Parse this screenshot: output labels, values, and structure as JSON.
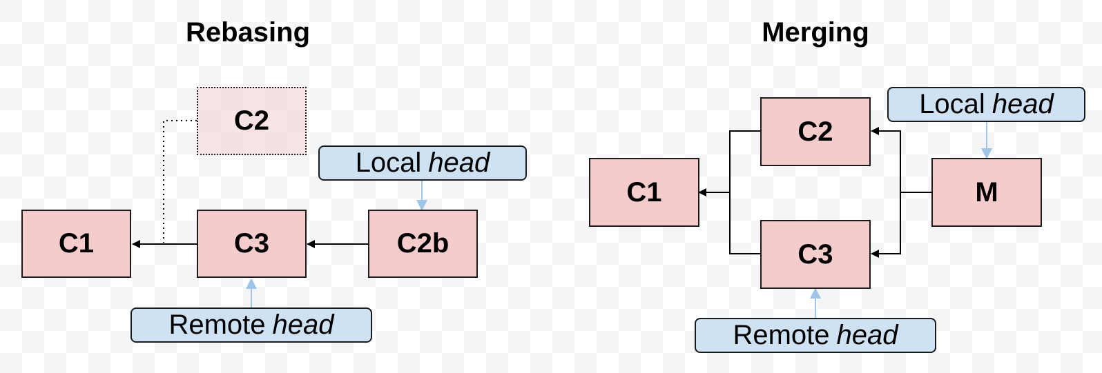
{
  "diagrams": {
    "rebasing": {
      "title": "Rebasing",
      "commits": {
        "c1": "C1",
        "c3": "C3",
        "c2b": "C2b",
        "c2_original": "C2"
      },
      "refs": {
        "local": {
          "label": "Local",
          "emphasis": "head",
          "points_to": "C2b"
        },
        "remote": {
          "label": "Remote",
          "emphasis": "head",
          "points_to": "C3"
        }
      },
      "edges": [
        {
          "from": "C3",
          "to": "C1",
          "style": "solid"
        },
        {
          "from": "C2b",
          "to": "C3",
          "style": "solid"
        },
        {
          "from": "C2",
          "to": "C1",
          "style": "dotted"
        }
      ]
    },
    "merging": {
      "title": "Merging",
      "commits": {
        "c1": "C1",
        "c2": "C2",
        "c3": "C3",
        "m": "M"
      },
      "refs": {
        "local": {
          "label": "Local",
          "emphasis": "head",
          "points_to": "M"
        },
        "remote": {
          "label": "Remote",
          "emphasis": "head",
          "points_to": "C3"
        }
      },
      "edges": [
        {
          "from": "C2",
          "to": "C1",
          "style": "solid"
        },
        {
          "from": "C3",
          "to": "C1",
          "style": "solid"
        },
        {
          "from": "M",
          "to": "C2",
          "style": "solid"
        },
        {
          "from": "M",
          "to": "C3",
          "style": "solid"
        }
      ]
    }
  },
  "colors": {
    "commit_fill": "#f4cccc",
    "ref_fill": "#cfe2f3",
    "ref_arrow": "#9fc5e8",
    "edge": "#000000"
  }
}
